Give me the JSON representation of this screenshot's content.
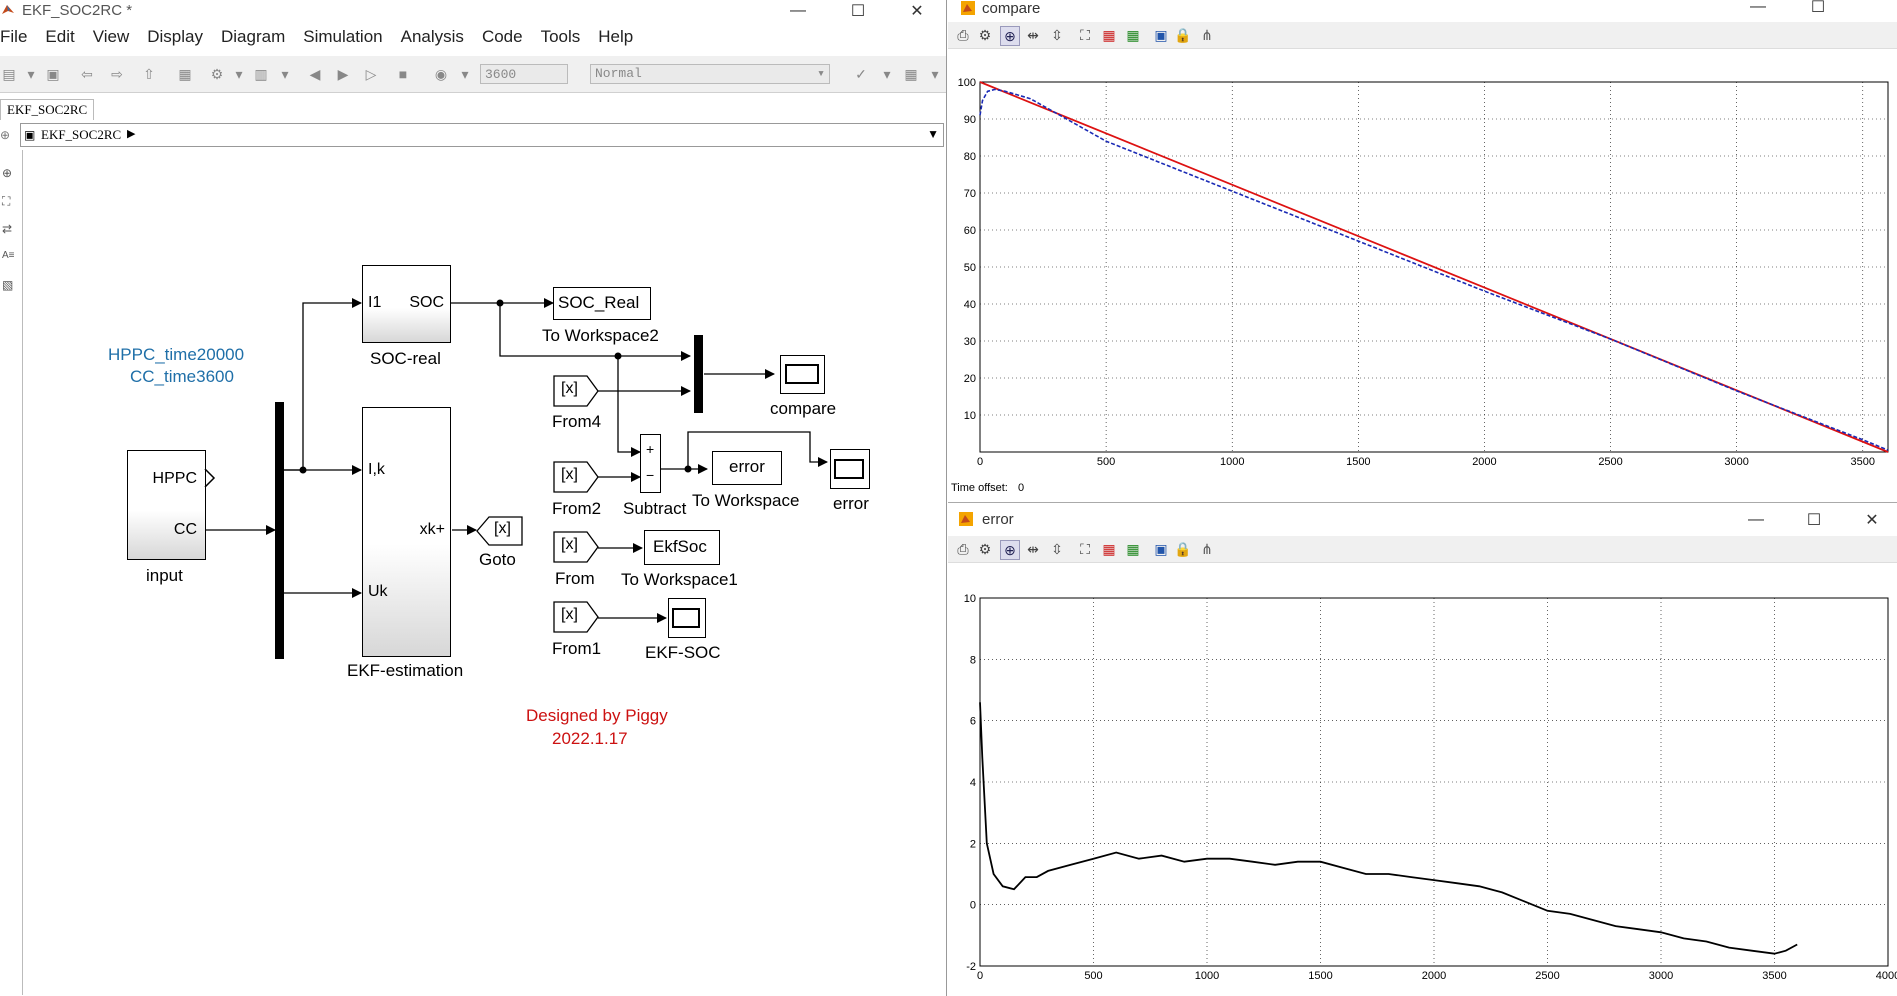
{
  "simulink": {
    "title": "EKF_SOC2RC *",
    "menu": [
      "File",
      "Edit",
      "View",
      "Display",
      "Diagram",
      "Simulation",
      "Analysis",
      "Code",
      "Tools",
      "Help"
    ],
    "stop_time": "3600",
    "sim_mode": "Normal",
    "tab_label": "EKF_SOC2RC",
    "breadcrumb": "EKF_SOC2RC",
    "annotation_top": [
      "HPPC_time20000",
      "CC_time3600"
    ],
    "annotation_bottom": [
      "Designed by Piggy",
      "2022.1.17"
    ],
    "annotation_top_color": "#1f6fa8",
    "annotation_bottom_color": "#cc1111",
    "blocks": {
      "input": {
        "name": "input",
        "ports": [
          "HPPC",
          "CC"
        ]
      },
      "soc_real": {
        "name": "SOC-real",
        "in_port": "I1",
        "out_port": "SOC"
      },
      "ekf": {
        "name": "EKF-estimation",
        "in_ports": [
          "I,k",
          "Uk"
        ],
        "out_port": "xk+"
      },
      "goto": {
        "name": "Goto",
        "tag": "[x]"
      },
      "to_ws2": {
        "name": "To Workspace2",
        "var": "SOC_Real"
      },
      "compare": {
        "name": "compare"
      },
      "from4": {
        "name": "From4",
        "tag": "[x]"
      },
      "from2": {
        "name": "From2",
        "tag": "[x]"
      },
      "subtract": {
        "name": "Subtract",
        "signs": [
          "+",
          "−"
        ]
      },
      "to_ws": {
        "name": "To Workspace",
        "var": "error"
      },
      "error_scope": {
        "name": "error"
      },
      "from": {
        "name": "From",
        "tag": "[x]"
      },
      "to_ws1": {
        "name": "To Workspace1",
        "var": "EkfSoc"
      },
      "from1": {
        "name": "From1",
        "tag": "[x]"
      },
      "ekf_soc": {
        "name": "EKF-SOC"
      }
    }
  },
  "compare_fig": {
    "title": "compare",
    "time_offset_label": "Time offset:",
    "time_offset_value": "0"
  },
  "error_fig": {
    "title": "error"
  },
  "chart_data": [
    {
      "type": "line",
      "title": "",
      "xlabel": "",
      "ylabel": "",
      "xlim": [
        0,
        3600
      ],
      "ylim": [
        0,
        100
      ],
      "xticks": [
        0,
        500,
        1000,
        1500,
        2000,
        2500,
        3000,
        3500
      ],
      "yticks": [
        10,
        20,
        30,
        40,
        50,
        60,
        70,
        80,
        90,
        100
      ],
      "grid": true,
      "series": [
        {
          "color": "#dd1111",
          "style": "solid",
          "x": [
            0,
            3600
          ],
          "y": [
            100,
            0
          ]
        },
        {
          "color": "#1a2ab5",
          "style": "dashed",
          "x": [
            0,
            10,
            30,
            60,
            100,
            200,
            500,
            1000,
            1500,
            2000,
            2500,
            3000,
            3500,
            3600
          ],
          "y": [
            91,
            95,
            97.5,
            98,
            97.5,
            95.5,
            84,
            70.5,
            57,
            43.5,
            30.5,
            16.5,
            3.3,
            0.5
          ]
        }
      ]
    },
    {
      "type": "line",
      "title": "",
      "xlabel": "",
      "ylabel": "",
      "xlim": [
        0,
        4000
      ],
      "ylim": [
        -2,
        10
      ],
      "xticks": [
        0,
        500,
        1000,
        1500,
        2000,
        2500,
        3000,
        3500,
        4000
      ],
      "yticks": [
        -2,
        0,
        2,
        4,
        6,
        8,
        10
      ],
      "grid": true,
      "series": [
        {
          "color": "#000000",
          "style": "solid",
          "x": [
            0,
            10,
            30,
            60,
            100,
            150,
            200,
            250,
            300,
            400,
            500,
            600,
            700,
            800,
            900,
            1000,
            1100,
            1200,
            1300,
            1400,
            1500,
            1600,
            1700,
            1800,
            1900,
            2000,
            2100,
            2200,
            2300,
            2400,
            2500,
            2600,
            2700,
            2800,
            2900,
            3000,
            3100,
            3200,
            3300,
            3400,
            3500,
            3550,
            3600
          ],
          "y": [
            6.6,
            4.8,
            2.0,
            1.0,
            0.6,
            0.5,
            0.9,
            0.9,
            1.1,
            1.3,
            1.5,
            1.7,
            1.5,
            1.6,
            1.4,
            1.5,
            1.5,
            1.4,
            1.3,
            1.4,
            1.4,
            1.2,
            1.0,
            1.0,
            0.9,
            0.8,
            0.7,
            0.6,
            0.4,
            0.1,
            -0.2,
            -0.3,
            -0.5,
            -0.7,
            -0.8,
            -0.9,
            -1.1,
            -1.2,
            -1.4,
            -1.5,
            -1.6,
            -1.5,
            -1.3
          ]
        }
      ]
    }
  ]
}
